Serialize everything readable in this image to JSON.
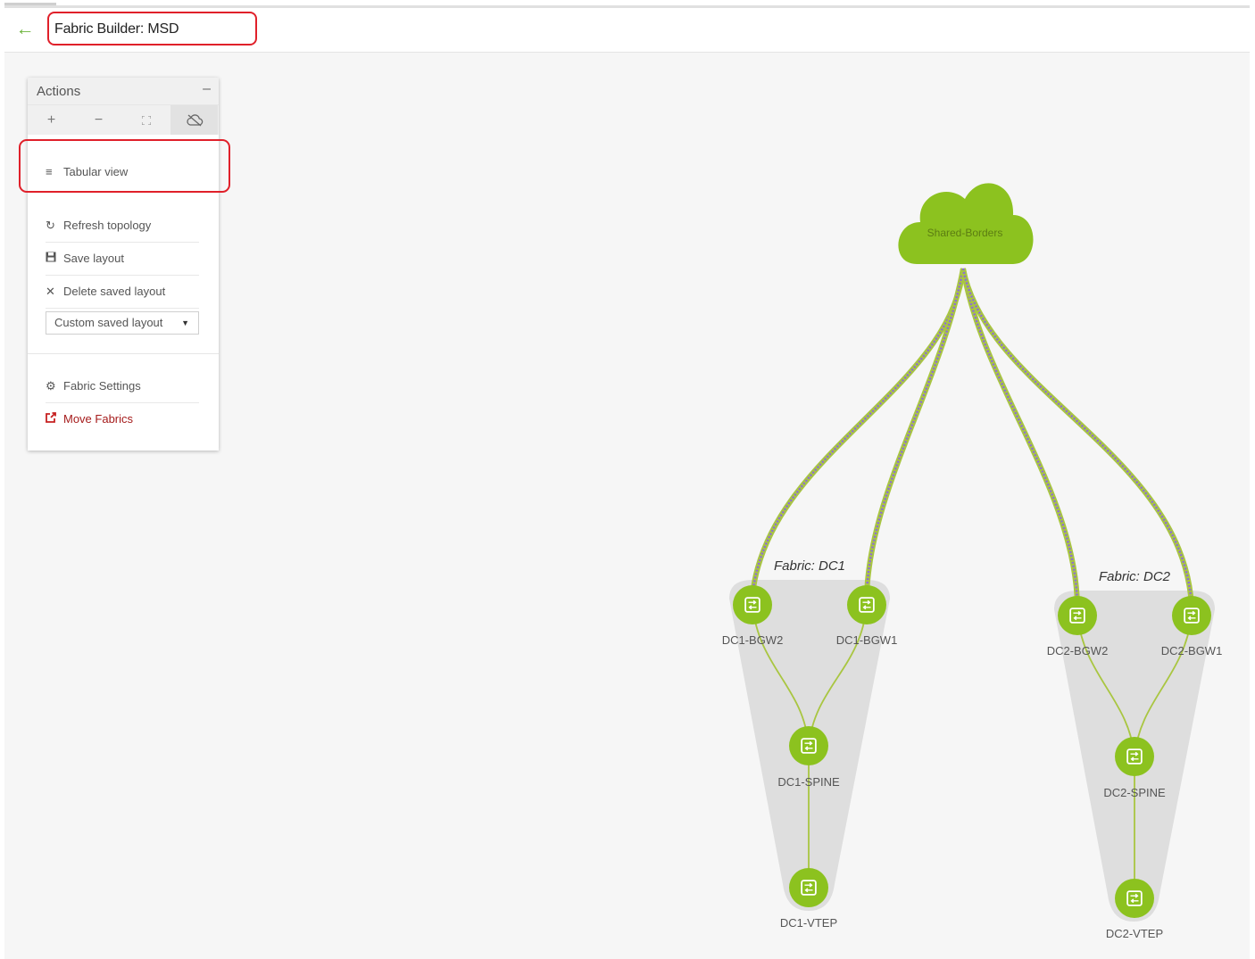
{
  "header": {
    "back_icon": "arrow-left-icon",
    "title": "Fabric Builder: MSD"
  },
  "actions_panel": {
    "title": "Actions",
    "collapse_label": "–",
    "toolbar": [
      {
        "name": "zoom-in",
        "glyph": "+"
      },
      {
        "name": "zoom-out",
        "glyph": "−"
      },
      {
        "name": "fit-to-screen",
        "glyph": "⛶"
      },
      {
        "name": "cloud-toggle",
        "glyph": "☁"
      }
    ],
    "tabular_view": "Tabular view",
    "refresh_topology": "Refresh topology",
    "save_layout": "Save layout",
    "delete_saved_layout": "Delete saved layout",
    "layout_select_value": "Custom saved layout",
    "fabric_settings": "Fabric Settings",
    "move_fabrics": "Move Fabrics"
  },
  "topology": {
    "cloud_label": "Shared-Borders",
    "fabrics": [
      {
        "label": "Fabric: DC1",
        "nodes": [
          "DC1-BGW2",
          "DC1-BGW1",
          "DC1-SPINE",
          "DC1-VTEP"
        ]
      },
      {
        "label": "Fabric: DC2",
        "nodes": [
          "DC2-BGW2",
          "DC2-BGW1",
          "DC2-SPINE",
          "DC2-VTEP"
        ]
      }
    ]
  },
  "colors": {
    "accent_green": "#8cc21f",
    "link_purple": "#8d6cd8",
    "highlight_red": "#e0202a",
    "danger_text": "#a51b1b"
  }
}
